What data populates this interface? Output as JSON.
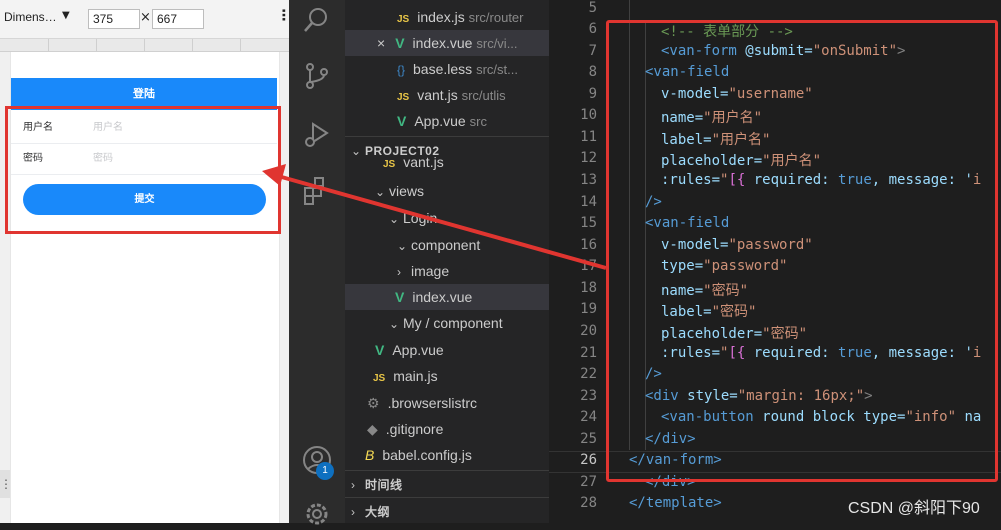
{
  "devtools": {
    "device_select": "Dimens…",
    "width": "375",
    "height": "667",
    "times": "×",
    "more": "⋮"
  },
  "app": {
    "nav_title": "登陆",
    "username_label": "用户名",
    "username_placeholder": "用户名",
    "password_label": "密码",
    "password_placeholder": "密码",
    "submit_label": "提交"
  },
  "activity": {
    "badge": "1"
  },
  "explorer": {
    "rows": [
      {
        "icon": "JS",
        "name": "index.js",
        "hint": "src/router"
      },
      {
        "icon": "V",
        "name": "index.vue",
        "hint": "src/vi..."
      },
      {
        "icon": "{}",
        "name": "base.less",
        "hint": "src/st..."
      },
      {
        "icon": "JS",
        "name": "vant.js",
        "hint": "src/utlis"
      },
      {
        "icon": "V",
        "name": "App.vue",
        "hint": "src"
      }
    ],
    "project_header": "PROJECT02",
    "tree": [
      {
        "icon": "JS",
        "name": "vant.js"
      },
      {
        "chev": "⌄",
        "name": "views"
      },
      {
        "chev": "⌄",
        "name": "Login"
      },
      {
        "chev": "⌄",
        "name": "component"
      },
      {
        "chev": "›",
        "name": "image"
      },
      {
        "icon": "V",
        "name": "index.vue"
      },
      {
        "chev": "⌄",
        "name": "My / component"
      },
      {
        "icon": "V",
        "name": "App.vue"
      },
      {
        "icon": "JS",
        "name": "main.js"
      },
      {
        "icon": "⚙",
        "name": ".browserslistrc"
      },
      {
        "icon": "◆",
        "name": ".gitignore"
      },
      {
        "icon": "B",
        "name": "babel.config.js"
      }
    ],
    "timeline": "时间线",
    "outline": "大纲",
    "close_glyph": "×"
  },
  "editor": {
    "line_numbers": [
      "5",
      "6",
      "7",
      "8",
      "9",
      "10",
      "11",
      "12",
      "13",
      "14",
      "15",
      "16",
      "17",
      "18",
      "19",
      "20",
      "21",
      "22",
      "23",
      "24",
      "25",
      "26",
      "27",
      "28"
    ],
    "active_line": "26",
    "code_lines": {
      "l6": "<!-- 表单部分 -->",
      "l7a": "<van-form",
      "l7b": " @submit=",
      "l7c": "\"onSubmit\"",
      "l7d": ">",
      "l8": "<van-field",
      "l9a": "v-model=",
      "l9b": "\"username\"",
      "l10a": "name=",
      "l10b": "\"用户名\"",
      "l11a": "label=",
      "l11b": "\"用户名\"",
      "l12a": "placeholder=",
      "l12b": "\"用户名\"",
      "l13a": ":rules=",
      "l13b": "\"",
      "l13c": "[{",
      "l13d": " required: ",
      "l13e": "true",
      "l13f": ", message: '",
      "l13g": "i",
      "l14": "/>",
      "l15": "<van-field",
      "l16a": "v-model=",
      "l16b": "\"password\"",
      "l17a": "type=",
      "l17b": "\"password\"",
      "l18a": "name=",
      "l18b": "\"密码\"",
      "l19a": "label=",
      "l19b": "\"密码\"",
      "l20a": "placeholder=",
      "l20b": "\"密码\"",
      "l21a": ":rules=",
      "l21b": "\"",
      "l21c": "[{",
      "l21d": " required: ",
      "l21e": "true",
      "l21f": ", message: '",
      "l21g": "i",
      "l22": "/>",
      "l23a": "<div",
      "l23b": " style=",
      "l23c": "\"margin: 16px;\"",
      "l23d": ">",
      "l24a": "<van-button",
      "l24b": " round block type=",
      "l24c": "\"info\"",
      "l24d": " na",
      "l25": "</div>",
      "l26": "</van-form>",
      "l27": "</div>",
      "l28": "</template>"
    }
  },
  "watermark": "CSDN @斜阳下90",
  "colors": {
    "accent": "#1989fa",
    "annotation_red": "#e03530"
  }
}
